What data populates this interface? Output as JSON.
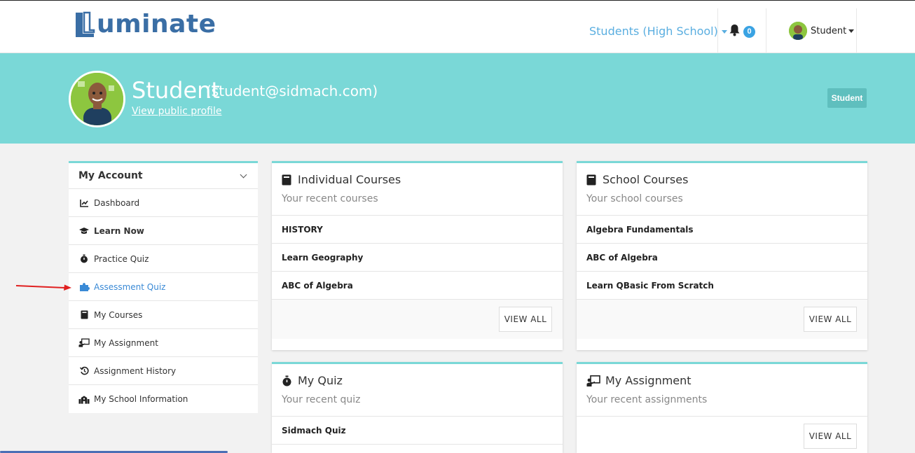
{
  "brand": {
    "name": "uminate",
    "color": "#3a6ea5"
  },
  "nav": {
    "role_label": "Students (High School)",
    "notifications_count": "0",
    "user_label": "Student"
  },
  "profile": {
    "name": "Student",
    "email": "(student@sidmach.com)",
    "public_link": "View public profile",
    "role_tag": "Student"
  },
  "sidebar": {
    "title": "My Account",
    "items": [
      {
        "label": "Dashboard",
        "icon": "chart-icon"
      },
      {
        "label": "Learn Now",
        "icon": "graduation-cap-icon"
      },
      {
        "label": "Practice Quiz",
        "icon": "stopwatch-icon"
      },
      {
        "label": "Assessment Quiz",
        "icon": "puzzle-icon"
      },
      {
        "label": "My Courses",
        "icon": "book-icon"
      },
      {
        "label": "My Assignment",
        "icon": "teacher-icon"
      },
      {
        "label": "Assignment History",
        "icon": "history-icon"
      },
      {
        "label": "My School Information",
        "icon": "school-icon"
      }
    ]
  },
  "cards": {
    "individual": {
      "title": "Individual Courses",
      "subtitle": "Your recent courses",
      "rows": [
        "HISTORY",
        "Learn Geography",
        "ABC of Algebra"
      ],
      "button": "VIEW ALL"
    },
    "school": {
      "title": "School Courses",
      "subtitle": "Your school courses",
      "rows": [
        "Algebra Fundamentals",
        "ABC of Algebra",
        "Learn QBasic From Scratch"
      ],
      "button": "VIEW ALL"
    },
    "quiz": {
      "title": "My Quiz",
      "subtitle": "Your recent quiz",
      "rows": [
        "Sidmach Quiz"
      ]
    },
    "assignment": {
      "title": "My Assignment",
      "subtitle": "Your recent assignments",
      "button": "VIEW ALL"
    }
  },
  "colors": {
    "accent": "#7ad8d7",
    "link": "#3a8ad6",
    "badge": "#3aa3e3"
  }
}
